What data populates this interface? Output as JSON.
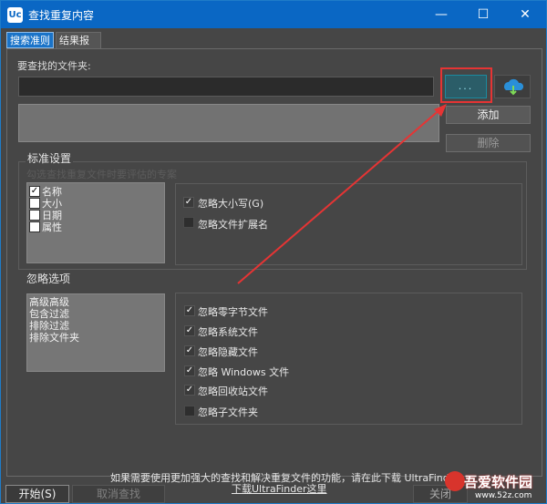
{
  "window": {
    "title": "查找重复内容",
    "logo_letter": "Uc"
  },
  "tabs": [
    {
      "label": "搜索准则"
    },
    {
      "label": "结果报告"
    }
  ],
  "folder": {
    "label": "要查找的文件夹:",
    "value": "",
    "browse_label": "...",
    "add_label": "添加",
    "delete_label": "删除"
  },
  "standard": {
    "title": "标准设置",
    "hint": "勾选查找重复文件时要评估的专案",
    "criteria": [
      {
        "label": "名称",
        "checked": true
      },
      {
        "label": "大小",
        "checked": false
      },
      {
        "label": "日期",
        "checked": false
      },
      {
        "label": "属性",
        "checked": false
      }
    ],
    "options": [
      {
        "label": "忽略大小写(G)",
        "checked": true
      },
      {
        "label": "忽略文件扩展名",
        "checked": false
      }
    ]
  },
  "ignore": {
    "title": "忽略选项",
    "list": [
      "高级高级",
      "包含过滤",
      "排除过滤",
      "排除文件夹"
    ],
    "options": [
      {
        "label": "忽略零字节文件",
        "checked": true
      },
      {
        "label": "忽略系统文件",
        "checked": true
      },
      {
        "label": "忽略隐藏文件",
        "checked": true
      },
      {
        "label": "忽略 Windows 文件",
        "checked": true
      },
      {
        "label": "忽略回收站文件",
        "checked": true
      },
      {
        "label": "忽略子文件夹",
        "checked": false
      }
    ]
  },
  "info": {
    "text": "如果需要使用更加强大的查找和解决重复文件的功能，请在此下载 UltraFinder",
    "link": "下载UltraFinder这里"
  },
  "buttons": {
    "start": "开始(S)",
    "cancel": "取消查找",
    "close": "关闭"
  },
  "watermark": {
    "text": "吾爱软件园",
    "url": "www.52z.com"
  },
  "colors": {
    "titlebar": "#0a67c4",
    "highlight": "#e63434",
    "accent": "#1a73c8"
  }
}
